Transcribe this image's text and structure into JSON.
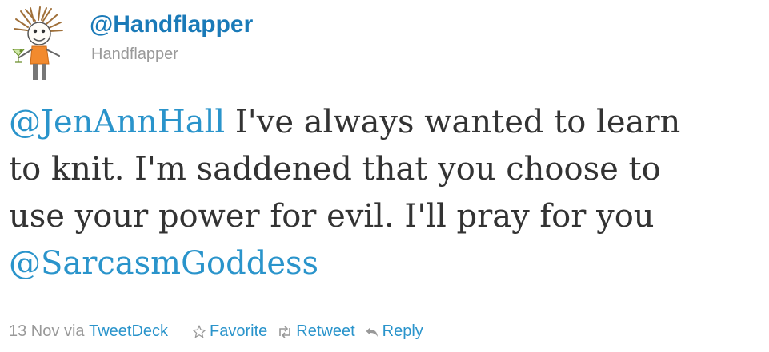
{
  "user": {
    "screen_name": "@Handflapper",
    "full_name": "Handflapper",
    "avatar_icon": "stick-figure-avatar-icon"
  },
  "tweet": {
    "lines": [
      [
        {
          "text": "@JenAnnHall",
          "mention": true
        },
        {
          "text": " I've always wanted to learn",
          "mention": false
        }
      ],
      [
        {
          "text": "to knit. I'm saddened that you choose to",
          "mention": false
        }
      ],
      [
        {
          "text": "use your power for evil. I'll pray for you",
          "mention": false
        }
      ],
      [
        {
          "text": "@SarcasmGoddess",
          "mention": true
        }
      ]
    ]
  },
  "meta": {
    "date": "13 Nov",
    "via_prefix": "via",
    "source": "TweetDeck"
  },
  "actions": {
    "favorite": "Favorite",
    "retweet": "Retweet",
    "reply": "Reply"
  },
  "colors": {
    "link": "#2a94cb",
    "screen_name": "#1a7ab8",
    "muted": "#999999",
    "text": "#333333"
  }
}
